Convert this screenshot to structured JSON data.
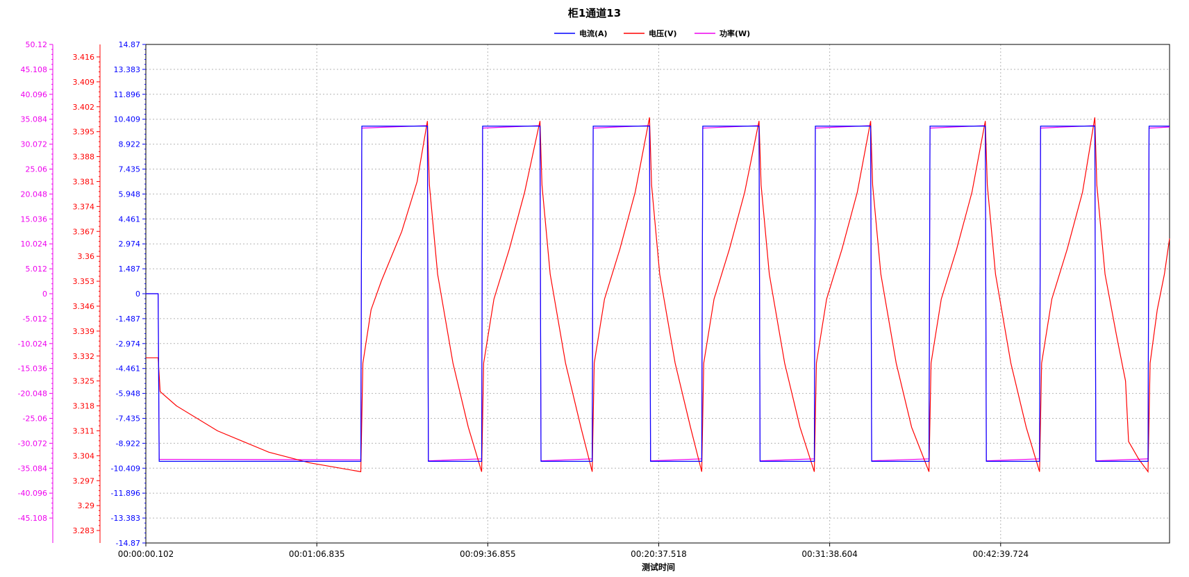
{
  "colors": {
    "current": "#0000ff",
    "voltage": "#ff0000",
    "power": "#ee00ee",
    "grid": "#b4b4b4",
    "axis": "#000000"
  },
  "chart_data": {
    "type": "line",
    "title": "柜1通道13",
    "xlabel": "测试时间",
    "xlim": [
      0,
      100
    ],
    "x_ticks": [
      {
        "pos": 0,
        "label": "00:00:00.102"
      },
      {
        "pos": 16.7,
        "label": "00:01:06.835"
      },
      {
        "pos": 33.4,
        "label": "00:09:36.855"
      },
      {
        "pos": 50.1,
        "label": "00:20:37.518"
      },
      {
        "pos": 66.8,
        "label": "00:31:38.604"
      },
      {
        "pos": 83.5,
        "label": "00:42:39.724"
      }
    ],
    "legend": {
      "placement": "top-center",
      "entries": [
        "电流(A)",
        "电压(V)",
        "功率(W)"
      ]
    },
    "y_axes": [
      {
        "name": "功率(W)",
        "color": "#ee00ee",
        "min": -50.12,
        "max": 50.12,
        "ticks": [
          "50.12",
          "45.108",
          "40.096",
          "35.084",
          "30.072",
          "25.06",
          "20.048",
          "15.036",
          "10.024",
          "5.012",
          "0",
          "-5.012",
          "-10.024",
          "-15.036",
          "-20.048",
          "-25.06",
          "-30.072",
          "-35.084",
          "-40.096",
          "-45.108"
        ]
      },
      {
        "name": "电压(V)",
        "color": "#ff0000",
        "min": 3.2795,
        "max": 3.4195,
        "ticks": [
          "3.416",
          "3.409",
          "3.402",
          "3.395",
          "3.388",
          "3.381",
          "3.374",
          "3.367",
          "3.36",
          "3.353",
          "3.346",
          "3.339",
          "3.332",
          "3.325",
          "3.318",
          "3.311",
          "3.304",
          "3.297",
          "3.29",
          "3.283"
        ]
      },
      {
        "name": "电流(A)",
        "color": "#0000ff",
        "min": -14.87,
        "max": 14.87,
        "ticks": [
          "14.87",
          "13.383",
          "11.896",
          "10.409",
          "8.922",
          "7.435",
          "5.948",
          "4.461",
          "2.974",
          "1.487",
          "0",
          "-1.487",
          "-2.974",
          "-4.461",
          "-5.948",
          "-7.435",
          "-8.922",
          "-10.409",
          "-11.896",
          "-13.383",
          "-14.87"
        ]
      }
    ],
    "series": [
      {
        "name": "电流(A)",
        "axis": 2,
        "points": [
          [
            0,
            0
          ],
          [
            1.2,
            0
          ],
          [
            1.3,
            -10
          ],
          [
            21,
            -10
          ],
          [
            21.1,
            10
          ],
          [
            27.5,
            10
          ],
          [
            27.6,
            -10
          ],
          [
            32.8,
            -10
          ],
          [
            32.9,
            10
          ],
          [
            38.5,
            10
          ],
          [
            38.6,
            -10
          ],
          [
            43.6,
            -10
          ],
          [
            43.7,
            10
          ],
          [
            49.2,
            10
          ],
          [
            49.3,
            -10
          ],
          [
            54.3,
            -10
          ],
          [
            54.4,
            10
          ],
          [
            59.9,
            10
          ],
          [
            60,
            -10
          ],
          [
            65.3,
            -10
          ],
          [
            65.4,
            10
          ],
          [
            70.8,
            10
          ],
          [
            70.9,
            -10
          ],
          [
            76.5,
            -10
          ],
          [
            76.6,
            10
          ],
          [
            82,
            10
          ],
          [
            82.1,
            -10
          ],
          [
            87.3,
            -10
          ],
          [
            87.4,
            10
          ],
          [
            92.7,
            10
          ],
          [
            92.8,
            -10
          ],
          [
            97.9,
            -10
          ],
          [
            98,
            10
          ],
          [
            100,
            10
          ]
        ]
      },
      {
        "name": "电压(V)",
        "axis": 1,
        "points": [
          [
            0,
            3.3315
          ],
          [
            1.2,
            3.3315
          ],
          [
            1.4,
            3.322
          ],
          [
            3,
            3.318
          ],
          [
            7,
            3.311
          ],
          [
            12,
            3.305
          ],
          [
            16,
            3.302
          ],
          [
            21,
            3.2995
          ],
          [
            21.2,
            3.33
          ],
          [
            22,
            3.345
          ],
          [
            23,
            3.353
          ],
          [
            25,
            3.367
          ],
          [
            26.5,
            3.381
          ],
          [
            27.5,
            3.398
          ],
          [
            27.7,
            3.38
          ],
          [
            28.5,
            3.355
          ],
          [
            30,
            3.33
          ],
          [
            31.5,
            3.312
          ],
          [
            32.8,
            3.2995
          ],
          [
            33,
            3.33
          ],
          [
            34,
            3.348
          ],
          [
            35.5,
            3.362
          ],
          [
            37,
            3.378
          ],
          [
            38.5,
            3.398
          ],
          [
            38.7,
            3.38
          ],
          [
            39.5,
            3.355
          ],
          [
            41,
            3.33
          ],
          [
            42.5,
            3.312
          ],
          [
            43.6,
            3.2995
          ],
          [
            43.8,
            3.33
          ],
          [
            44.8,
            3.348
          ],
          [
            46.3,
            3.362
          ],
          [
            47.8,
            3.378
          ],
          [
            49.2,
            3.399
          ],
          [
            49.4,
            3.38
          ],
          [
            50.2,
            3.355
          ],
          [
            51.7,
            3.33
          ],
          [
            53.2,
            3.312
          ],
          [
            54.3,
            3.2995
          ],
          [
            54.5,
            3.33
          ],
          [
            55.5,
            3.348
          ],
          [
            57,
            3.362
          ],
          [
            58.5,
            3.378
          ],
          [
            59.9,
            3.398
          ],
          [
            60.1,
            3.38
          ],
          [
            60.9,
            3.355
          ],
          [
            62.4,
            3.33
          ],
          [
            63.9,
            3.312
          ],
          [
            65.3,
            3.2995
          ],
          [
            65.5,
            3.33
          ],
          [
            66.5,
            3.348
          ],
          [
            68,
            3.362
          ],
          [
            69.5,
            3.378
          ],
          [
            70.8,
            3.398
          ],
          [
            71,
            3.38
          ],
          [
            71.8,
            3.355
          ],
          [
            73.3,
            3.33
          ],
          [
            74.8,
            3.312
          ],
          [
            76.5,
            3.2995
          ],
          [
            76.7,
            3.33
          ],
          [
            77.7,
            3.348
          ],
          [
            79.2,
            3.362
          ],
          [
            80.7,
            3.378
          ],
          [
            82,
            3.398
          ],
          [
            82.2,
            3.38
          ],
          [
            83,
            3.355
          ],
          [
            84.5,
            3.33
          ],
          [
            86,
            3.312
          ],
          [
            87.3,
            3.2995
          ],
          [
            87.5,
            3.33
          ],
          [
            88.5,
            3.348
          ],
          [
            90,
            3.362
          ],
          [
            91.5,
            3.378
          ],
          [
            92.7,
            3.399
          ],
          [
            92.9,
            3.38
          ],
          [
            93.7,
            3.355
          ],
          [
            94.8,
            3.338
          ],
          [
            95.7,
            3.325
          ],
          [
            96,
            3.308
          ],
          [
            97,
            3.303
          ],
          [
            97.9,
            3.2995
          ],
          [
            98.1,
            3.33
          ],
          [
            98.8,
            3.345
          ],
          [
            99.5,
            3.355
          ],
          [
            100,
            3.365
          ]
        ]
      },
      {
        "name": "功率(W)",
        "axis": 0,
        "points": [
          [
            0,
            0
          ],
          [
            1.2,
            0
          ],
          [
            1.3,
            -33.3
          ],
          [
            21,
            -33.4
          ],
          [
            21.1,
            33.3
          ],
          [
            27.5,
            33.8
          ],
          [
            27.6,
            -33.6
          ],
          [
            32.8,
            -33.2
          ],
          [
            32.9,
            33.3
          ],
          [
            38.5,
            33.8
          ],
          [
            38.6,
            -33.6
          ],
          [
            43.6,
            -33.2
          ],
          [
            43.7,
            33.3
          ],
          [
            49.2,
            33.8
          ],
          [
            49.3,
            -33.6
          ],
          [
            54.3,
            -33.2
          ],
          [
            54.4,
            33.3
          ],
          [
            59.9,
            33.8
          ],
          [
            60,
            -33.6
          ],
          [
            65.3,
            -33.2
          ],
          [
            65.4,
            33.3
          ],
          [
            70.8,
            33.8
          ],
          [
            70.9,
            -33.6
          ],
          [
            76.5,
            -33.2
          ],
          [
            76.6,
            33.3
          ],
          [
            82,
            33.8
          ],
          [
            82.1,
            -33.6
          ],
          [
            87.3,
            -33.2
          ],
          [
            87.4,
            33.3
          ],
          [
            92.7,
            33.8
          ],
          [
            92.8,
            -33.6
          ],
          [
            97.9,
            -33.2
          ],
          [
            98,
            33.3
          ],
          [
            100,
            33.5
          ]
        ]
      }
    ]
  }
}
